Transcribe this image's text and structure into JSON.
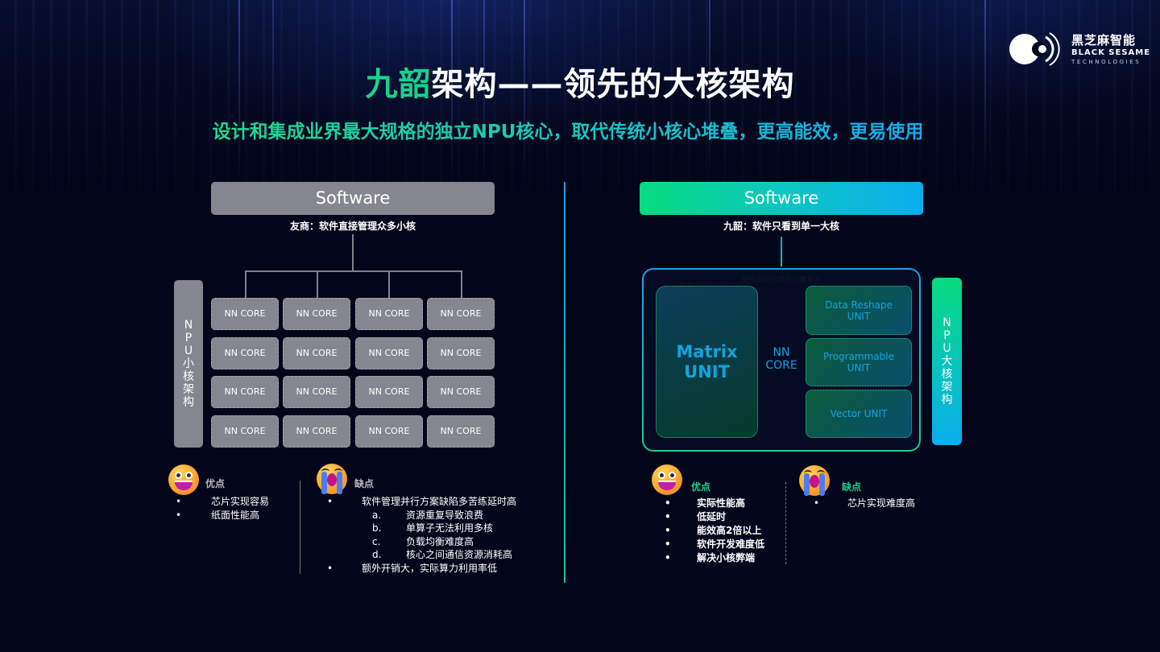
{
  "logo": {
    "cn": "黑芝麻智能",
    "en_line1": "BLACK SESAME",
    "en_line2": "TECHNOLOGIES"
  },
  "title": {
    "highlight": "九韶",
    "rest": "架构——领先的大核架构"
  },
  "subtitle": "设计和集成业界最大规格的独立NPU核心，取代传统小核心堆叠，更高能效，更易使用",
  "colors": {
    "accent_green": "#18d28c",
    "accent_blue": "#0aaeef",
    "gray_block": "#85868f",
    "background": "#03061a"
  },
  "left": {
    "software_label": "Software",
    "caption": "友商：软件直接管理众多小核",
    "npu_label_chars": [
      "N",
      "P",
      "U",
      "小",
      "核",
      "架",
      "构"
    ],
    "core_label": "NN CORE",
    "grid_rows": 4,
    "grid_cols": 4,
    "pros": {
      "title": "优点",
      "items": [
        "芯片实现容易",
        "纸面性能高"
      ]
    },
    "cons": {
      "title": "缺点",
      "items": [
        {
          "text": "软件管理并行方案缺陷多苦练延时高",
          "sub": [
            {
              "mark": "a.",
              "text": "资源重复导致浪费"
            },
            {
              "mark": "b.",
              "text": "单算子无法利用多核"
            },
            {
              "mark": "c.",
              "text": "负载均衡难度高"
            },
            {
              "mark": "d.",
              "text": "核心之间通信资源消耗高"
            }
          ]
        },
        {
          "text": "额外开销大，实际算力利用率低",
          "sub": []
        }
      ]
    }
  },
  "right": {
    "software_label": "Software",
    "caption": "九韶：软件只看到单一大核",
    "hw_note": "硬件协同管理多计算单元",
    "matrix_unit": [
      "Matrix",
      "UNIT"
    ],
    "nn_core": [
      "NN",
      "CORE"
    ],
    "units": [
      [
        "Data Reshape",
        "UNIT"
      ],
      [
        "Programmable",
        "UNIT"
      ],
      [
        "Vector UNIT"
      ]
    ],
    "npu_label_chars": [
      "N",
      "P",
      "U",
      "大",
      "核",
      "架",
      "构"
    ],
    "pros": {
      "title": "优点",
      "items": [
        "实际性能高",
        "低延时",
        "能效高2倍以上",
        "软件开发难度低",
        "解决小核弊端"
      ]
    },
    "cons": {
      "title": "缺点",
      "items": [
        "芯片实现难度高"
      ]
    }
  },
  "bullet_char": "•"
}
